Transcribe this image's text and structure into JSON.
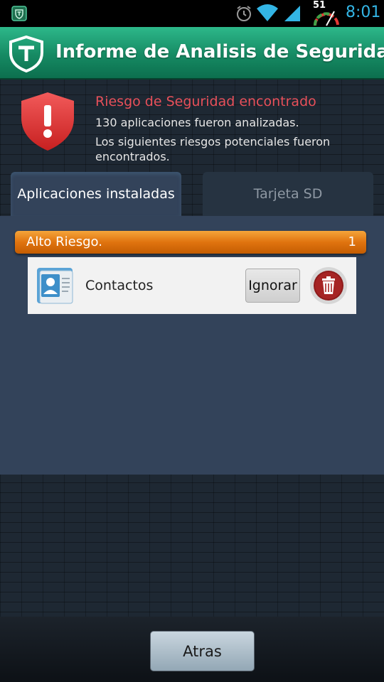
{
  "status_bar": {
    "battery_level": "51",
    "time": "8:01",
    "icons": [
      "app-notification-icon",
      "alarm-icon",
      "wifi-icon",
      "signal-icon",
      "battery-gauge-icon"
    ]
  },
  "header": {
    "title": "Informe de Analisis de Seguridad",
    "logo_icon": "shield-t-logo-icon"
  },
  "warning": {
    "icon": "shield-alert-icon",
    "title": "Riesgo de Seguridad encontrado",
    "line1": "130 aplicaciones fueron analizadas.",
    "line2": "Los siguientes riesgos potenciales fueron",
    "line3": "encontrados."
  },
  "tabs": [
    {
      "label": "Aplicaciones instaladas",
      "selected": true
    },
    {
      "label": "Tarjeta SD",
      "selected": false
    }
  ],
  "risk_group": {
    "label": "Alto Riesgo.",
    "count": "1"
  },
  "apps": [
    {
      "name": "Contactos",
      "icon": "contacts-icon",
      "ignore_label": "Ignorar",
      "delete_icon": "trash-icon"
    }
  ],
  "footer": {
    "back_label": "Atras"
  },
  "colors": {
    "accent_green": "#168a63",
    "risk_red": "#e8505a",
    "high_risk_orange": "#e0730f",
    "time_blue": "#33b5e5"
  }
}
